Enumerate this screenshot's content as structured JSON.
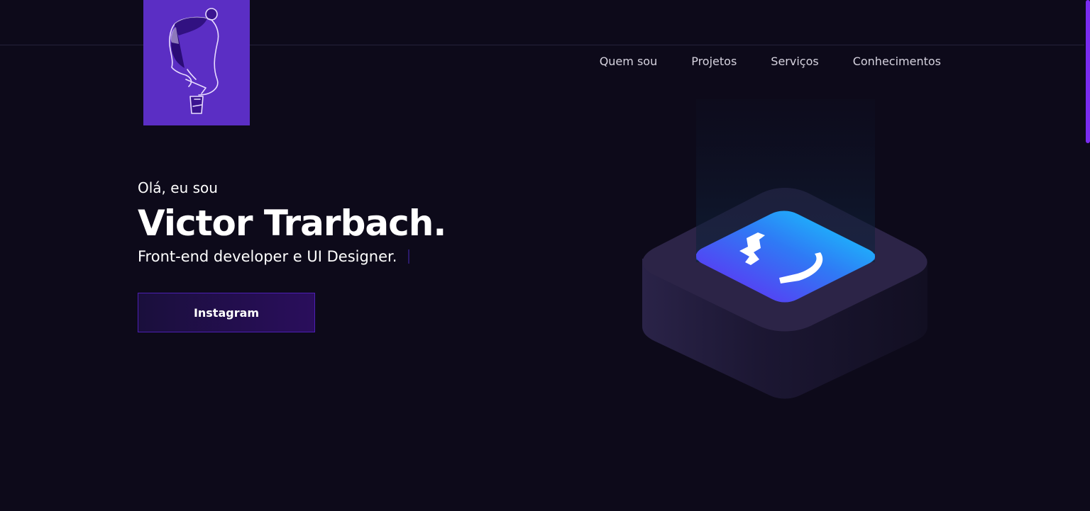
{
  "nav": {
    "items": [
      {
        "label": "Quem sou"
      },
      {
        "label": "Projetos"
      },
      {
        "label": "Serviços"
      },
      {
        "label": "Conhecimentos"
      }
    ]
  },
  "hero": {
    "greeting": "Olá, eu sou",
    "name": "Victor Trarbach.",
    "subtitle": "Front-end developer e UI Designer."
  },
  "cta": {
    "label": "Instagram"
  },
  "illustration": {
    "icon": "curly-braces-icon"
  },
  "colors": {
    "background": "#0d0a1a",
    "accent": "#5b2ec4",
    "cyan": "#1fd0ff",
    "button_border": "#4c1fb3"
  }
}
